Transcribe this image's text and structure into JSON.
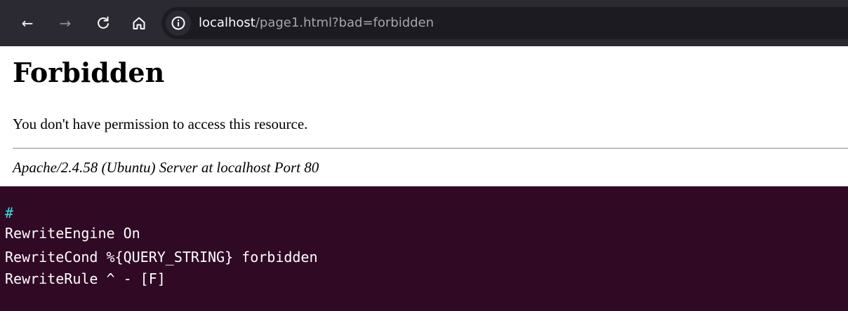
{
  "browser": {
    "nav": {
      "back_icon": "←",
      "forward_icon": "→",
      "reload_icon": "↻",
      "home_icon": "⌂"
    },
    "url": {
      "host": "localhost",
      "rest": "/page1.html?bad=forbidden"
    },
    "colors": {
      "toolbar": "#2b2a33",
      "urlbar": "#1c1b22"
    }
  },
  "page": {
    "title": "Forbidden",
    "message": "You don't have permission to access this resource.",
    "signature": "Apache/2.4.58 (Ubuntu) Server at localhost Port 80"
  },
  "terminal": {
    "background": "#300a24",
    "lines": [
      "#",
      "RewriteEngine On",
      "RewriteCond %{QUERY_STRING} forbidden",
      "RewriteRule ^ - [F]"
    ]
  }
}
